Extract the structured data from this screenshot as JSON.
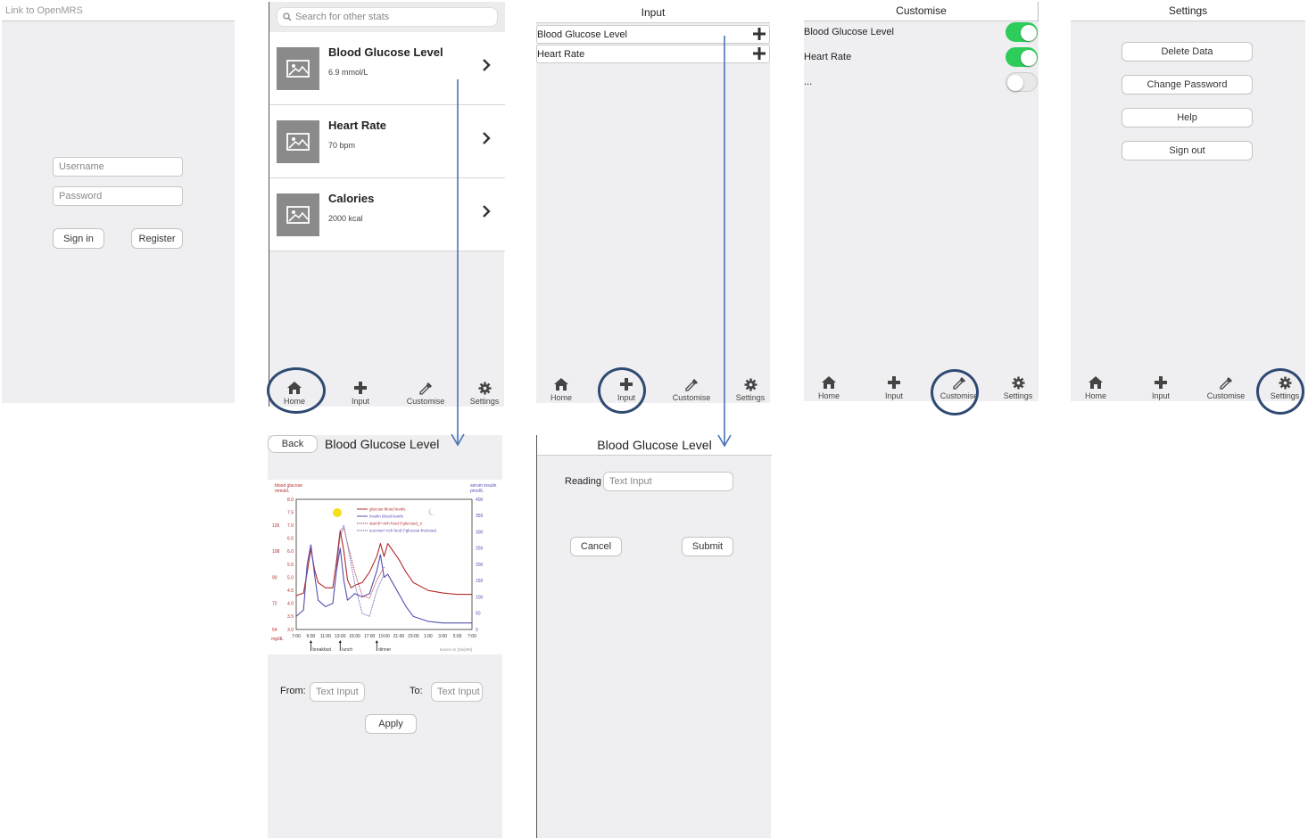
{
  "login": {
    "link_text": "Link to OpenMRS",
    "username_placeholder": "Username",
    "password_placeholder": "Password",
    "sign_in": "Sign in",
    "register": "Register"
  },
  "home": {
    "search_placeholder": "Search for other stats",
    "stats": [
      {
        "title": "Blood Glucose Level",
        "value": "6.9 mmol/L"
      },
      {
        "title": "Heart Rate",
        "value": "70 bpm"
      },
      {
        "title": "Calories",
        "value": "2000 kcal"
      }
    ]
  },
  "input_screen": {
    "title": "Input",
    "items": [
      "Blood Glucose Level",
      "Heart Rate"
    ]
  },
  "customise": {
    "title": "Customise",
    "items": [
      {
        "label": "Blood Glucose Level",
        "on": true
      },
      {
        "label": "Heart Rate",
        "on": true
      },
      {
        "label": "...",
        "on": false
      }
    ]
  },
  "settings": {
    "title": "Settings",
    "buttons": [
      "Delete Data",
      "Change Password",
      "Help",
      "Sign out"
    ]
  },
  "tabbar": {
    "labels": [
      "Home",
      "Input",
      "Customise",
      "Settings"
    ]
  },
  "detail": {
    "back": "Back",
    "title": "Blood Glucose Level",
    "from_label": "From:",
    "to_label": "To:",
    "from_placeholder": "Text Input",
    "to_placeholder": "Text Input",
    "apply": "Apply"
  },
  "entry": {
    "title": "Blood Glucose Level",
    "reading_label": "Reading",
    "reading_placeholder": "Text Input",
    "cancel": "Cancel",
    "submit": "Submit"
  },
  "colors": {
    "toggle_on": "#2ecc5a",
    "toggle_off": "#e8e8e8",
    "highlight_ring": "#2f4a72",
    "flow_arrow": "#4a72b8",
    "glucose_line": "#b22b2b",
    "insulin_line": "#5450b0"
  },
  "chart_data": {
    "type": "line",
    "left_axis_label": "blood glucose\nmmol/L",
    "right_axis_label": "serum insulin\npmol/L",
    "left_unit_alt": "mg/dL",
    "x_ticks": [
      "7:00",
      "9:00",
      "11:00",
      "13:00",
      "15:00",
      "17:00",
      "19:00",
      "21:00",
      "23:00",
      "1:00",
      "3:00",
      "5:00",
      "7:00"
    ],
    "y_left_ticks": [
      "3.0",
      "3.5",
      "4.0",
      "4.5",
      "5.0",
      "5.5",
      "6.0",
      "6.5",
      "7.0",
      "7.5",
      "8.0"
    ],
    "y_left_mgdl_ticks": [
      "54",
      "72",
      "90",
      "108",
      "126"
    ],
    "y_right_ticks": [
      "0",
      "50",
      "100",
      "150",
      "200",
      "250",
      "300",
      "350",
      "400"
    ],
    "ylim_left": [
      3.0,
      8.0
    ],
    "ylim_right": [
      0,
      400
    ],
    "legend": [
      "glucose blood levels",
      "insulin blood levels",
      "starch*-rich food (*glucose)_n",
      "sucrose*-rich food (*glucose-fructose)"
    ],
    "meal_labels": [
      "breakfast",
      "lunch",
      "dinner"
    ],
    "meal_hours": [
      9,
      13,
      18
    ],
    "source_note": "based on [Daly98]",
    "series": [
      {
        "name": "glucose blood levels",
        "style": "solid",
        "axis": "left",
        "points": [
          [
            7,
            4.3
          ],
          [
            8,
            4.4
          ],
          [
            8.5,
            5.2
          ],
          [
            9,
            6.1
          ],
          [
            9.5,
            5.3
          ],
          [
            10,
            4.8
          ],
          [
            11,
            4.6
          ],
          [
            12,
            4.6
          ],
          [
            12.5,
            5.6
          ],
          [
            13,
            6.8
          ],
          [
            13.5,
            6.0
          ],
          [
            14,
            4.9
          ],
          [
            14.5,
            4.6
          ],
          [
            15,
            4.7
          ],
          [
            16,
            4.8
          ],
          [
            17,
            5.2
          ],
          [
            18,
            5.8
          ],
          [
            18.5,
            6.3
          ],
          [
            19,
            5.8
          ],
          [
            19.5,
            6.3
          ],
          [
            20,
            6.1
          ],
          [
            21,
            5.7
          ],
          [
            22,
            5.2
          ],
          [
            23,
            4.8
          ],
          [
            1,
            4.5
          ],
          [
            3,
            4.4
          ],
          [
            5,
            4.35
          ],
          [
            7,
            4.35
          ]
        ]
      },
      {
        "name": "insulin blood levels",
        "style": "solid",
        "axis": "right",
        "points": [
          [
            7,
            40
          ],
          [
            8,
            60
          ],
          [
            8.5,
            200
          ],
          [
            9,
            260
          ],
          [
            9.5,
            170
          ],
          [
            10,
            90
          ],
          [
            11,
            70
          ],
          [
            12,
            80
          ],
          [
            12.5,
            180
          ],
          [
            13,
            250
          ],
          [
            13.5,
            150
          ],
          [
            14,
            90
          ],
          [
            14.5,
            100
          ],
          [
            15,
            110
          ],
          [
            16,
            100
          ],
          [
            17,
            110
          ],
          [
            18,
            180
          ],
          [
            18.5,
            230
          ],
          [
            19,
            160
          ],
          [
            19.5,
            170
          ],
          [
            20,
            150
          ],
          [
            21,
            110
          ],
          [
            22,
            70
          ],
          [
            23,
            40
          ],
          [
            1,
            25
          ],
          [
            3,
            20
          ],
          [
            5,
            20
          ],
          [
            7,
            20
          ]
        ]
      },
      {
        "name": "starch*-rich food (*glucose)_n",
        "style": "dotted",
        "axis": "left",
        "points": [
          [
            12.5,
            5.4
          ],
          [
            13,
            6.6
          ],
          [
            13.5,
            6.9
          ],
          [
            14,
            6.3
          ],
          [
            15,
            5.2
          ],
          [
            16,
            4.3
          ],
          [
            17,
            4.2
          ],
          [
            18,
            4.9
          ],
          [
            19,
            5.4
          ]
        ]
      },
      {
        "name": "sucrose*-rich food (*glucose-fructose)",
        "style": "dotted",
        "axis": "right",
        "points": [
          [
            12.5,
            180
          ],
          [
            13,
            300
          ],
          [
            13.5,
            320
          ],
          [
            14,
            260
          ],
          [
            15,
            140
          ],
          [
            16,
            50
          ],
          [
            17,
            40
          ],
          [
            18,
            120
          ],
          [
            19,
            170
          ]
        ]
      }
    ]
  }
}
